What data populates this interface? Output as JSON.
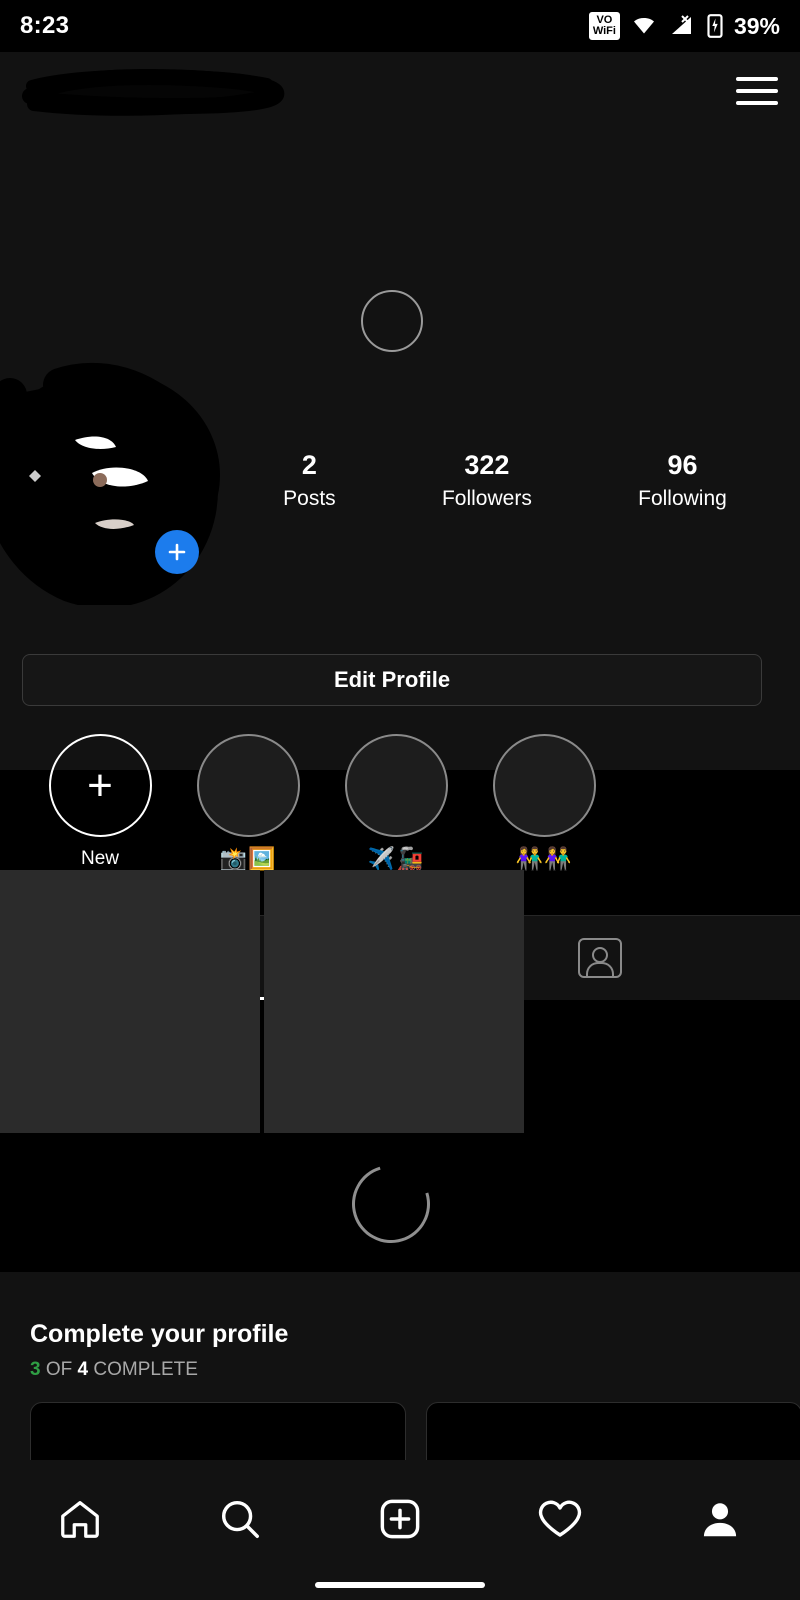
{
  "status_bar": {
    "time": "8:23",
    "volte_line1": "VO",
    "volte_line2": "WiFi",
    "wifi_icon": "wifi-icon",
    "signal_icon": "cellular-signal-icon",
    "no_sim_icon": "x-icon",
    "battery_icon": "battery-icon",
    "battery_percent": "39%"
  },
  "header": {
    "username": "",
    "username_redacted": true,
    "menu_icon": "hamburger-menu-icon"
  },
  "profile": {
    "avatar_redacted": true,
    "add_story_icon": "plus-icon",
    "add_story_color": "#1c7ced",
    "stats": [
      {
        "value": "2",
        "label": "Posts"
      },
      {
        "value": "322",
        "label": "Followers"
      },
      {
        "value": "96",
        "label": "Following"
      }
    ],
    "edit_profile_label": "Edit Profile"
  },
  "highlights": [
    {
      "type": "new",
      "label": "New",
      "icon": "plus-icon"
    },
    {
      "type": "highlight",
      "label": "📸🖼️"
    },
    {
      "type": "highlight",
      "label": "✈️🚂"
    },
    {
      "type": "highlight",
      "label": "👫👫"
    }
  ],
  "tabs": [
    {
      "id": "grid",
      "icon": "grid-icon",
      "active": true
    },
    {
      "id": "tagged",
      "icon": "tagged-person-icon",
      "active": false
    }
  ],
  "posts": [
    {
      "id": "post-1"
    },
    {
      "id": "post-2"
    }
  ],
  "loading": {
    "profile_spinner": "loading-spinner",
    "posts_spinner": "loading-spinner"
  },
  "complete_profile": {
    "title": "Complete your profile",
    "progress_done": "3",
    "progress_of": " OF ",
    "progress_total": "4",
    "progress_suffix": " COMPLETE",
    "done_color": "#2f9e44",
    "cards": [
      {
        "id": "card-1"
      },
      {
        "id": "card-2"
      }
    ]
  },
  "bottom_nav": [
    {
      "id": "home",
      "icon": "home-icon"
    },
    {
      "id": "search",
      "icon": "search-icon"
    },
    {
      "id": "create",
      "icon": "plus-square-icon"
    },
    {
      "id": "activity",
      "icon": "heart-icon"
    },
    {
      "id": "profile",
      "icon": "person-icon"
    }
  ]
}
